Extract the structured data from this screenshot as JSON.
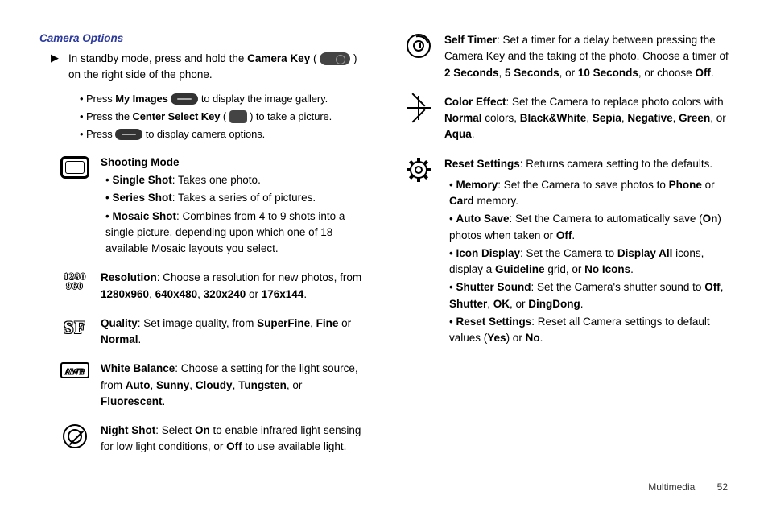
{
  "title": "Camera Options",
  "intro": {
    "pre": "In standby mode, press and hold the ",
    "cameraKey": "Camera Key",
    "post": " on the right side of the phone."
  },
  "introBullets": {
    "b1_pre": "Press ",
    "b1_bold": "My Images",
    "b1_post": " to display the image gallery.",
    "b2_pre": "Press the ",
    "b2_bold": "Center Select Key",
    "b2_post": " to take a picture.",
    "b3_pre": "Press ",
    "b3_post": " to display camera options."
  },
  "shootingMode": {
    "heading": "Shooting Mode",
    "single_b": "Single Shot",
    "single_t": ": Takes one photo.",
    "series_b": "Series Shot",
    "series_t": ": Takes a series of of pictures.",
    "mosaic_b": "Mosaic Shot",
    "mosaic_t": ": Combines from 4 to 9 shots into a single picture, depending upon which one of 18 available Mosaic layouts you select."
  },
  "resolution": {
    "label": "Resolution",
    "text1": ": Choose a resolution for new photos, from ",
    "r1": "1280x960",
    "r2": "640x480",
    "r3": "320x240",
    "or": " or ",
    "r4": "176x144",
    "period": ".",
    "icon1": "1280",
    "icon2": "960"
  },
  "quality": {
    "label": "Quality",
    "text1": ": Set image quality, from ",
    "q1": "SuperFine",
    "q2": "Fine",
    "or": " or ",
    "q3": "Normal",
    "period": ".",
    "icon": "SF"
  },
  "wb": {
    "label": "White Balance",
    "text1": ": Choose a setting for the light source, from ",
    "w1": "Auto",
    "w2": "Sunny",
    "w3": "Cloudy",
    "w4": "Tungsten",
    "or": ", or ",
    "w5": "Fluorescent",
    "period": ".",
    "icon": "AWB"
  },
  "night": {
    "label": "Night Shot",
    "text1": ": Select ",
    "on": "On",
    "text2": " to enable infrared light sensing for low light conditions, or ",
    "off": "Off",
    "text3": " to use available light."
  },
  "selftimer": {
    "label": "Self Timer",
    "text1": ": Set a timer for a delay between pressing the Camera Key and the taking of the photo. Choose a timer of ",
    "t1": "2 Seconds",
    "t2": "5 Seconds",
    "or": ", or ",
    "t3": "10 Seconds",
    "text2": ", or choose ",
    "off": "Off",
    "period": "."
  },
  "coloreffect": {
    "label": "Color Effect",
    "text1": ": Set the Camera to replace photo colors with ",
    "c1": "Normal",
    "mid": " colors, ",
    "c2": "Black&White",
    "c3": "Sepia",
    "c4": "Negative",
    "c5": "Green",
    "or": ", or ",
    "c6": "Aqua",
    "period": "."
  },
  "reset": {
    "label": "Reset Settings",
    "text1": ": Returns camera setting to the defaults.",
    "mem_b": "Memory",
    "mem_t1": ": Set the Camera to save photos to ",
    "mem_phone": "Phone",
    "mem_or": " or ",
    "mem_card": "Card",
    "mem_t2": " memory.",
    "auto_b": "Auto Save",
    "auto_t1": ": Set the Camera to automatically save (",
    "auto_on": "On",
    "auto_t2": ") photos when taken or ",
    "auto_off": "Off",
    "auto_t3": ".",
    "icon_b": "Icon Display",
    "icon_t1": ": Set the Camera to ",
    "icon_all": "Display All",
    "icon_t2": " icons, display a ",
    "icon_guide": "Guideline",
    "icon_t3": " grid, or ",
    "icon_no": "No Icons",
    "icon_t4": ".",
    "shut_b": "Shutter Sound",
    "shut_t1": ": Set the Camera's shutter sound to ",
    "shut_off": "Off",
    "shut_shutter": "Shutter",
    "shut_ok": "OK",
    "shut_or": ", or ",
    "shut_dd": "DingDong",
    "shut_t2": ".",
    "rs_b": "Reset Settings",
    "rs_t1": ": Reset all Camera settings to default values (",
    "rs_yes": "Yes",
    "rs_t2": ") or ",
    "rs_no": "No",
    "rs_t3": "."
  },
  "footer": {
    "section": "Multimedia",
    "page": "52"
  }
}
